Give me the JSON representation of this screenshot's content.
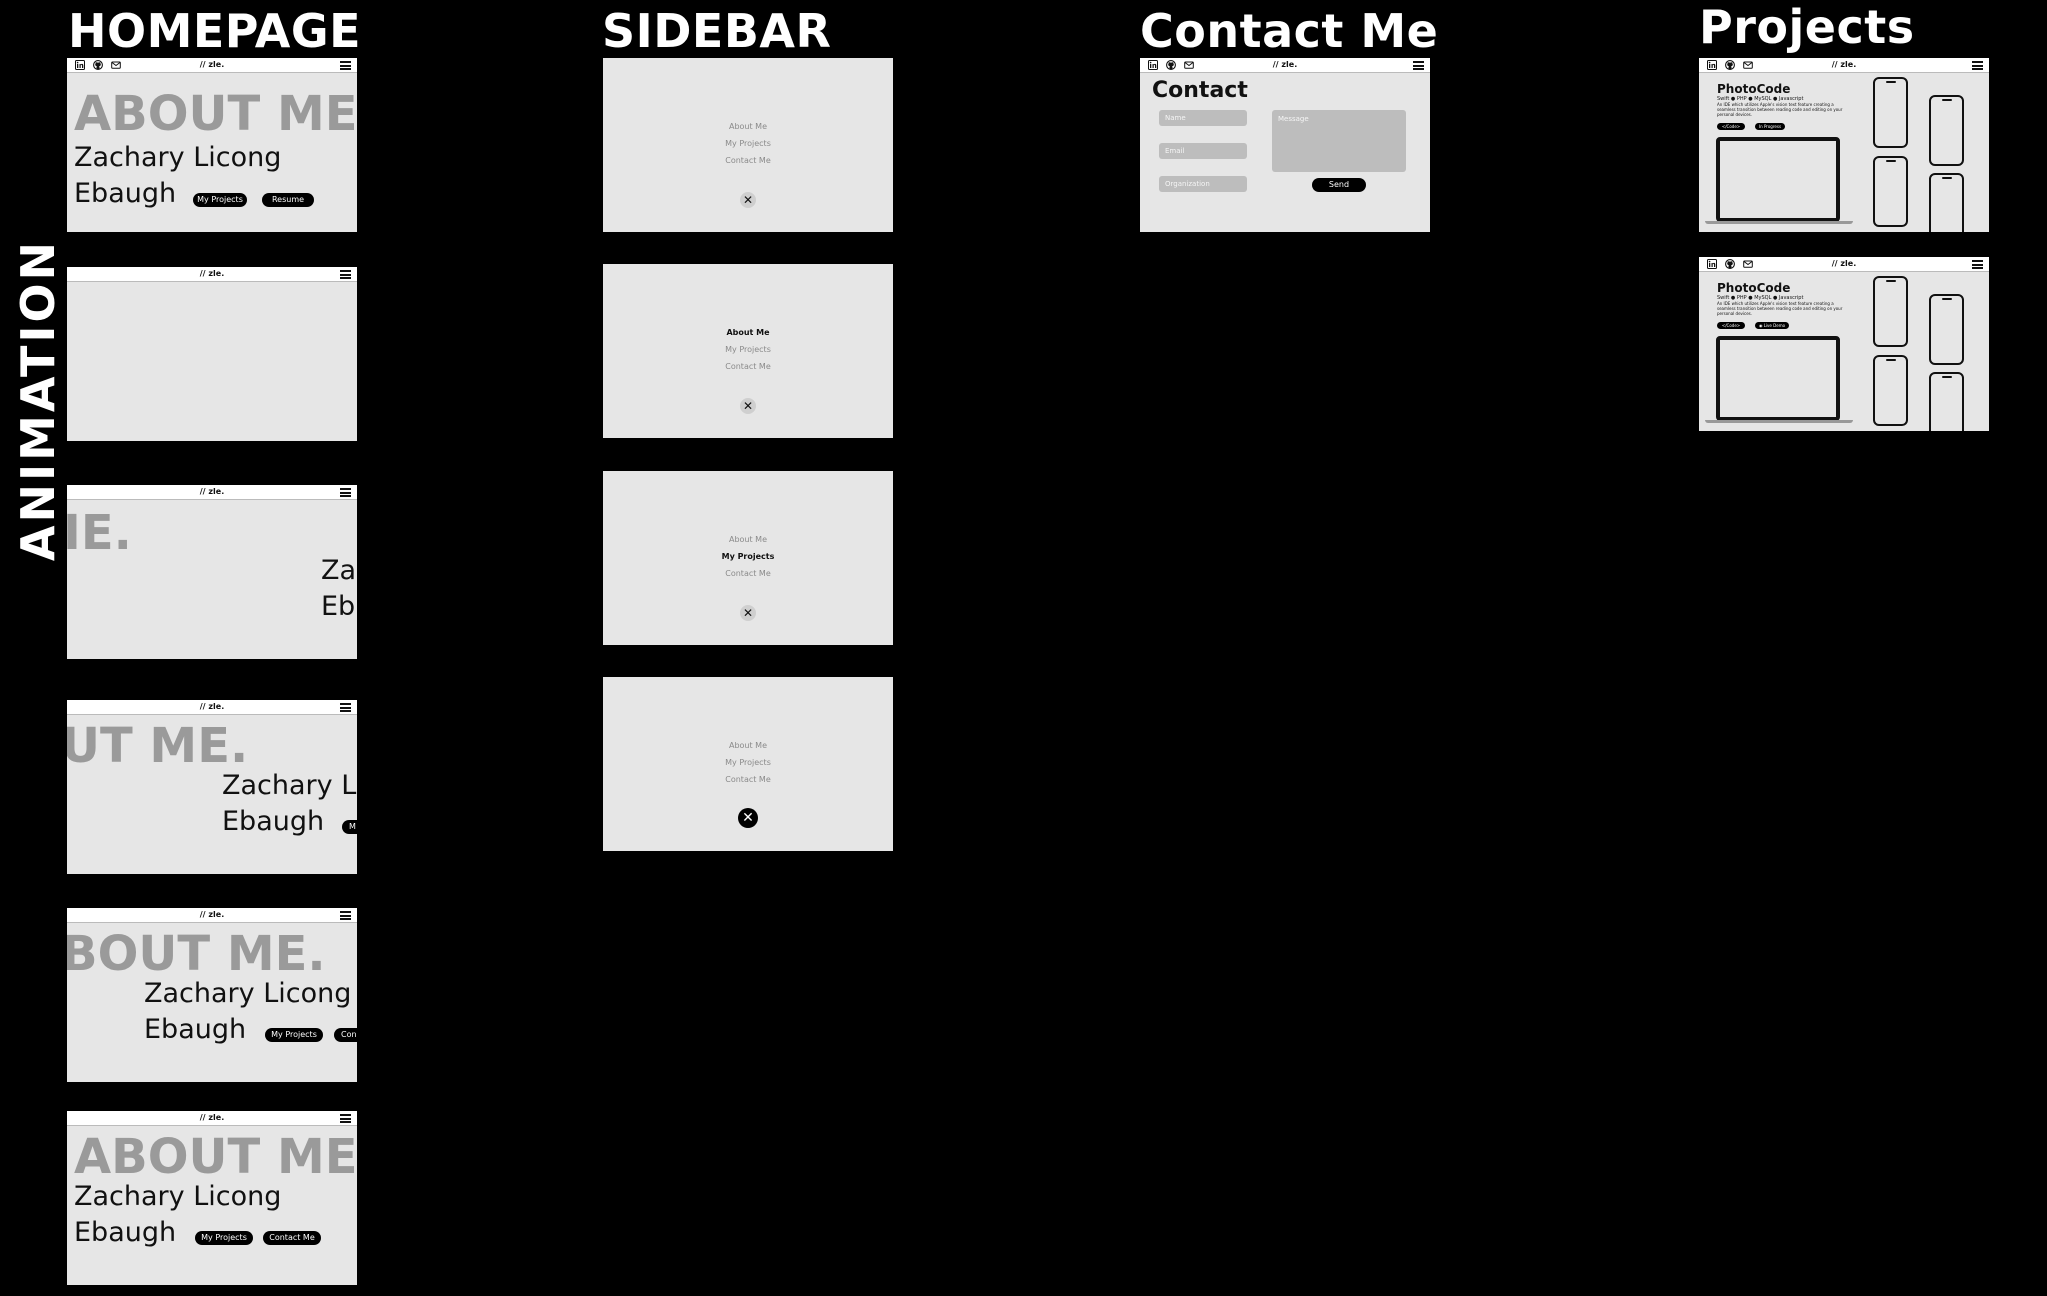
{
  "columns": {
    "homepage": "HOMEPAGE",
    "sidebar": "SIDEBAR",
    "contact": "Contact Me",
    "projects": "Projects"
  },
  "side_label": "ANIMATION",
  "site": {
    "logo": "// zle.",
    "about_heading": "ABOUT ME.",
    "first_line": "Zachary Licong",
    "second_line": "Ebaugh",
    "about_fragments": {
      "f3": "IE.",
      "f4": "UT ME.",
      "f5": "BOUT ME."
    },
    "name_fragments": {
      "za": "Za",
      "eb": "Eb",
      "zachary_l": "Zachary L"
    },
    "btn_projects": "My Projects",
    "btn_resume": "Resume",
    "btn_contact": "Contact Me",
    "btn_frag_m": "M",
    "btn_frag_con": "Con"
  },
  "sidebar_menu": [
    "About Me",
    "My Projects",
    "Contact Me"
  ],
  "sidebar_states": [
    {
      "active": -1
    },
    {
      "active": 0
    },
    {
      "active": 1
    },
    {
      "active": -1
    }
  ],
  "contact_form": {
    "title": "Contact",
    "name_placeholder": "Name",
    "email_placeholder": "Email",
    "org_placeholder": "Organization",
    "message_placeholder": "Message",
    "send": "Send"
  },
  "project": {
    "title": "PhotoCode",
    "tags": [
      "Swift",
      "PHP",
      "MySQL",
      "Javascript"
    ],
    "description": "An IDE which utilizes Apple's vision text feature creating a seamless transition between reading code and editing on your personal devices.",
    "btn_code": "</Code>",
    "btn_progress": "In Progress",
    "btn_demo": "Live Demo"
  },
  "icons": [
    "linkedin-icon",
    "github-icon",
    "mail-icon",
    "hamburger-menu-icon",
    "close-icon"
  ],
  "colors": {
    "background": "#000000",
    "frame": "#e6e6e6",
    "muted_heading": "#9a9a9a",
    "pill": "#000000"
  }
}
